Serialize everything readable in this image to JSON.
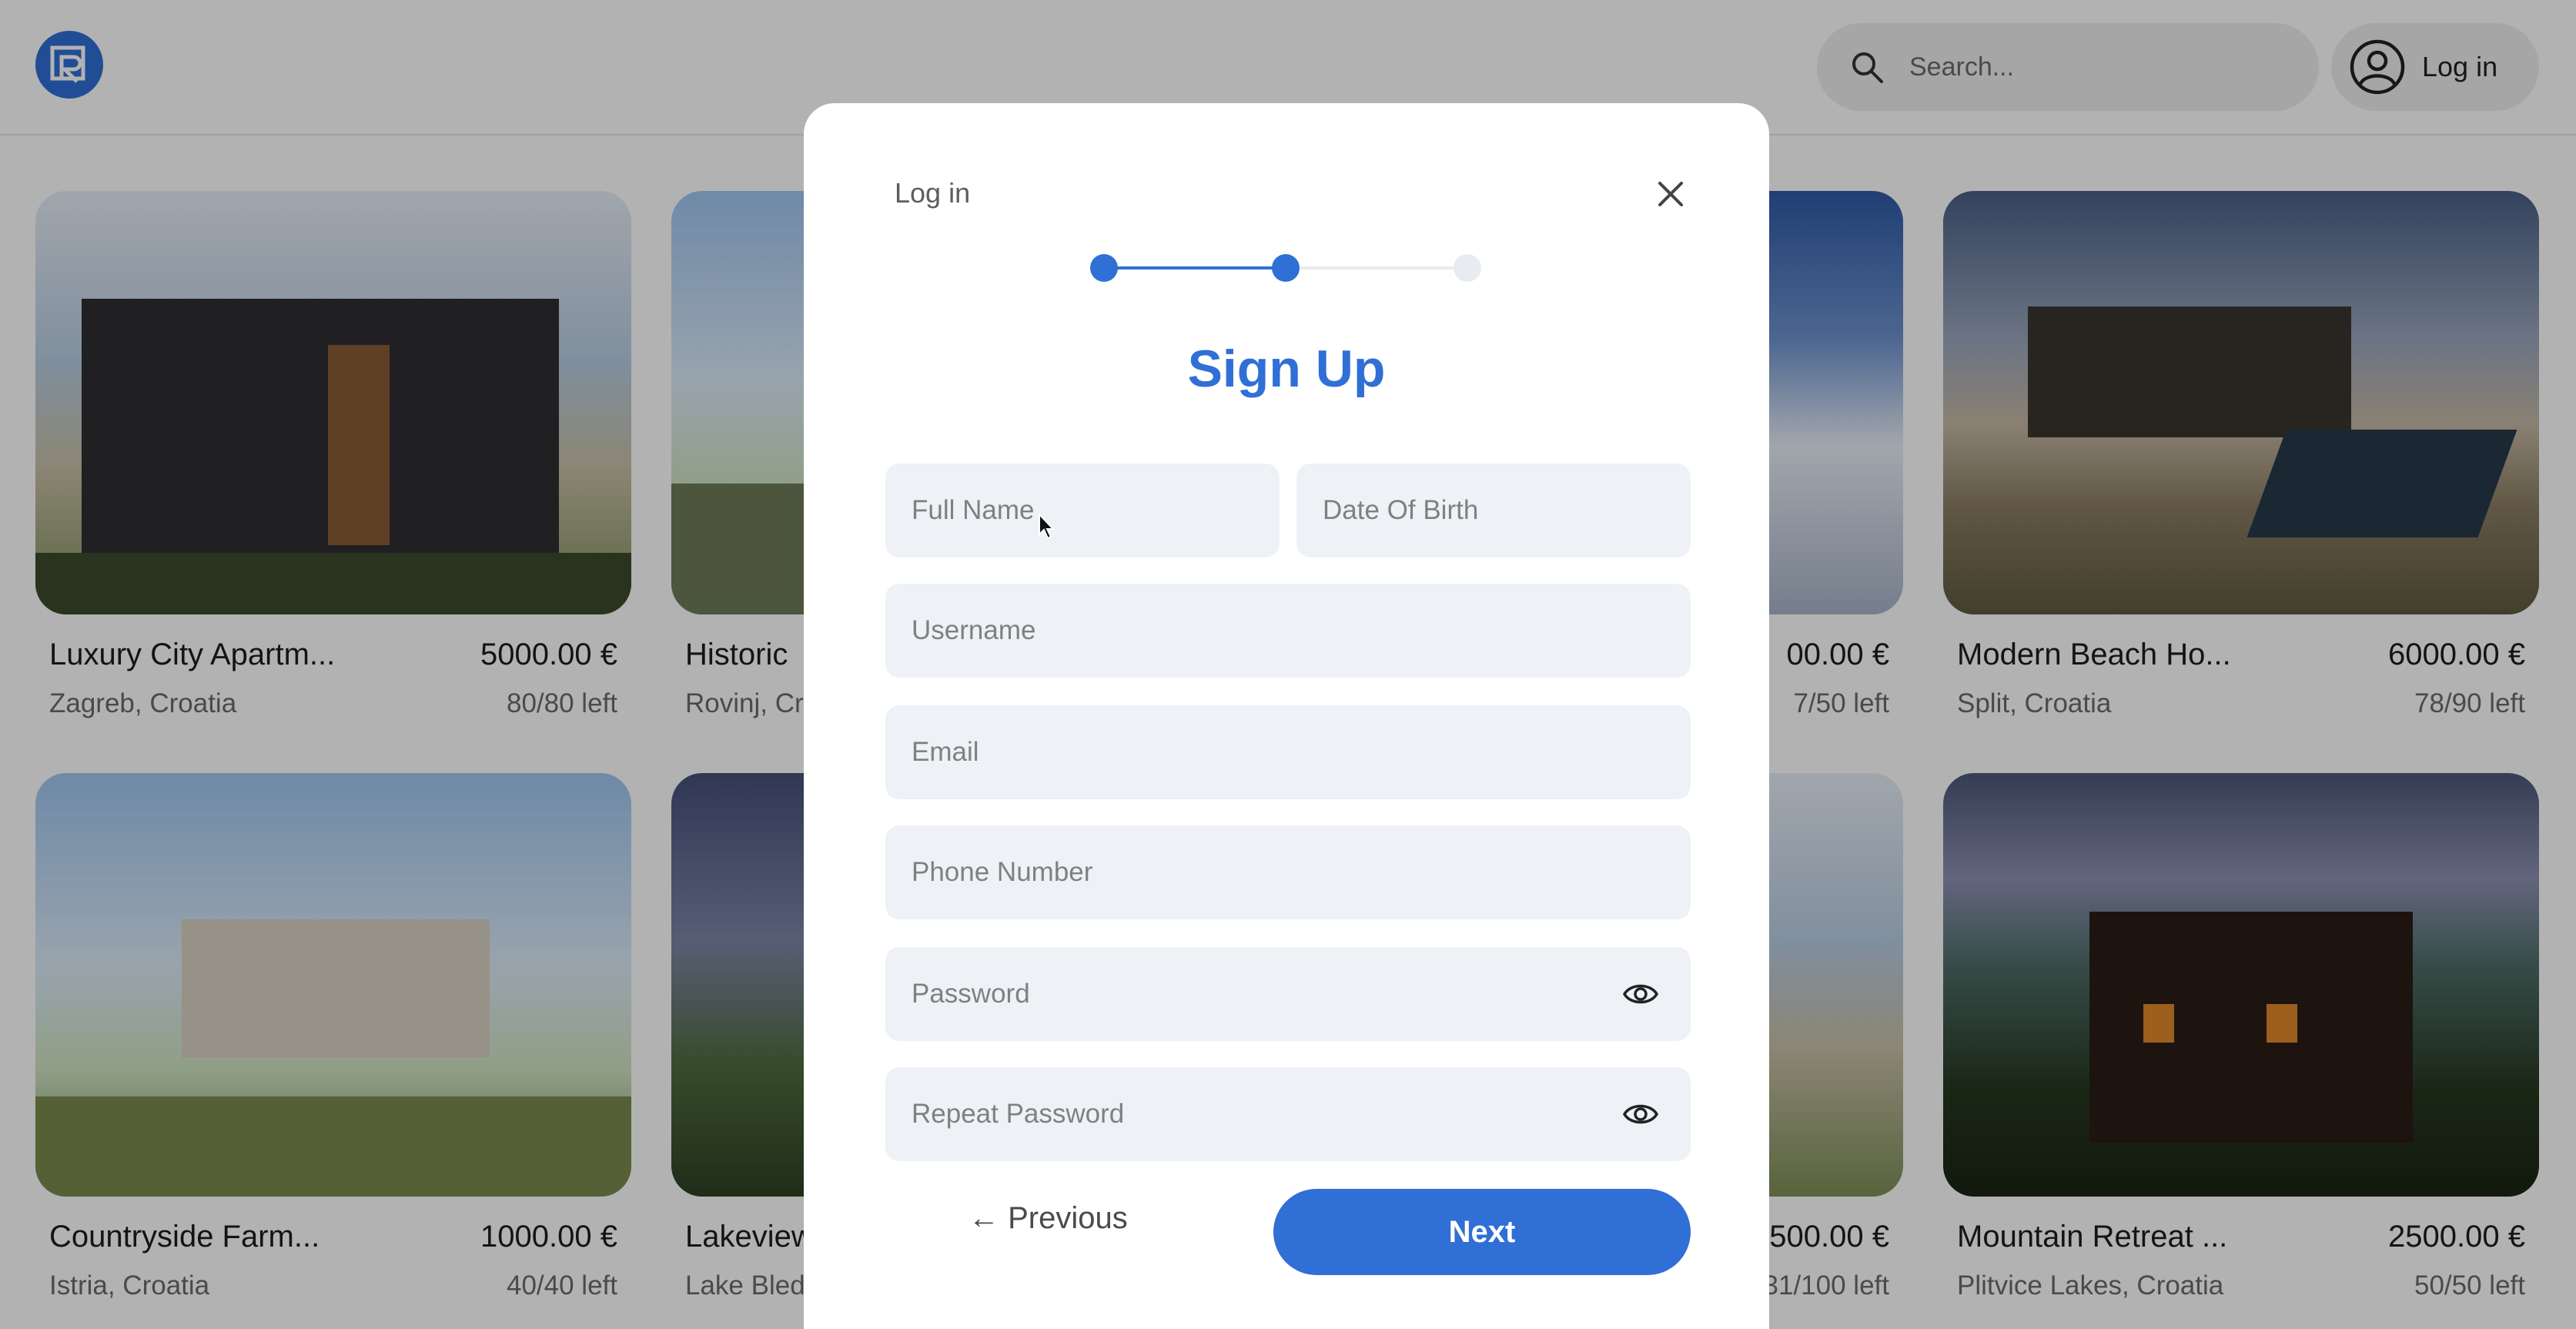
{
  "header": {
    "search_placeholder": "Search...",
    "login_label": "Log in"
  },
  "listings": [
    {
      "title": "Luxury City Apartm...",
      "price": "5000.00 €",
      "location": "Zagreb, Croatia",
      "availability": "80/80 left"
    },
    {
      "title": "Historic",
      "price": "",
      "location": "Rovinj, Cr",
      "availability": ""
    },
    {
      "title": "",
      "price": "00.00 €",
      "location": "",
      "availability": "7/50 left"
    },
    {
      "title": "Modern Beach Ho...",
      "price": "6000.00 €",
      "location": "Split, Croatia",
      "availability": "78/90 left"
    },
    {
      "title": "Countryside Farm...",
      "price": "1000.00 €",
      "location": "Istria, Croatia",
      "availability": "40/40 left"
    },
    {
      "title": "Lakeview",
      "price": "",
      "location": "Lake Bled",
      "availability": ""
    },
    {
      "title": "",
      "price": "500.00 €",
      "location": "",
      "availability": "31/100 left"
    },
    {
      "title": "Mountain Retreat ...",
      "price": "2500.00 €",
      "location": "Plitvice Lakes, Croatia",
      "availability": "50/50 left"
    }
  ],
  "modal": {
    "login_link": "Log in",
    "title": "Sign Up",
    "stepper": {
      "current_step": 2,
      "total_steps": 3
    },
    "fields": {
      "full_name": "Full Name",
      "date_of_birth": "Date Of Birth",
      "username": "Username",
      "email": "Email",
      "phone": "Phone Number",
      "password": "Password",
      "repeat_password": "Repeat Password"
    },
    "previous_label": "← Previous",
    "next_label": "Next"
  },
  "colors": {
    "accent": "#2f6fd6",
    "field_bg": "#eef2f6",
    "stepper_inactive": "#e8ecf1"
  },
  "icons": [
    "logo-icon",
    "search-icon",
    "user-icon",
    "close-icon",
    "eye-icon",
    "cursor-icon"
  ]
}
